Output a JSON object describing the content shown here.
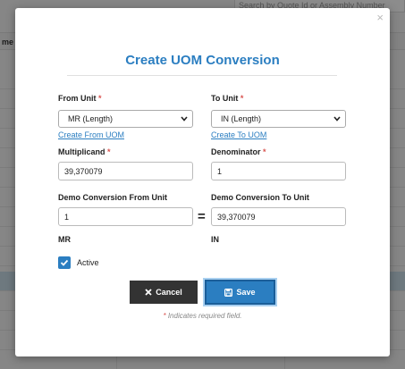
{
  "background": {
    "search_placeholder": "Search by Quote Id or Assembly Number",
    "column_header": "me"
  },
  "modal": {
    "title": "Create UOM Conversion",
    "close_glyph": "×",
    "from_unit": {
      "label": "From Unit",
      "required_mark": "*",
      "selected": "MR (Length)",
      "link": "Create From UOM"
    },
    "to_unit": {
      "label": "To Unit",
      "required_mark": "*",
      "selected": "IN (Length)",
      "link": "Create To UOM"
    },
    "multiplicand": {
      "label": "Multiplicand",
      "required_mark": "*",
      "value": "39,370079"
    },
    "denominator": {
      "label": "Denominator",
      "required_mark": "*",
      "value": "1"
    },
    "demo_from": {
      "label": "Demo Conversion From Unit",
      "value": "1",
      "unit": "MR"
    },
    "demo_to": {
      "label": "Demo Conversion To Unit",
      "value": "39,370079",
      "unit": "IN"
    },
    "equals": "=",
    "active": {
      "label": "Active",
      "checked": true
    },
    "cancel_label": "Cancel",
    "save_label": "Save",
    "required_note_mark": "*",
    "required_note": " Indicates required field."
  },
  "colors": {
    "accent": "#2b7ec1",
    "required": "#d9534f",
    "cancel_bg": "#333333"
  },
  "icons": {
    "cancel": "times-icon",
    "save": "floppy-disk-icon",
    "check": "check-icon",
    "select": "chevron-down-icon"
  }
}
